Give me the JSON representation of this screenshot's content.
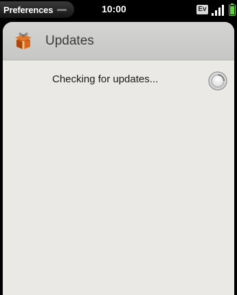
{
  "statusbar": {
    "app_menu_label": "Preferences",
    "time": "10:00",
    "network_badge": "EV",
    "signal_icon": "signal-bars-icon",
    "battery_icon": "battery-icon"
  },
  "header": {
    "icon": "updates-gift-icon",
    "title": "Updates"
  },
  "content": {
    "status_text": "Checking for updates...",
    "spinner_icon": "activity-spinner-icon"
  },
  "colors": {
    "card_background": "#eae9e6",
    "header_background": "#cacac8",
    "icon_orange": "#d9661f"
  }
}
